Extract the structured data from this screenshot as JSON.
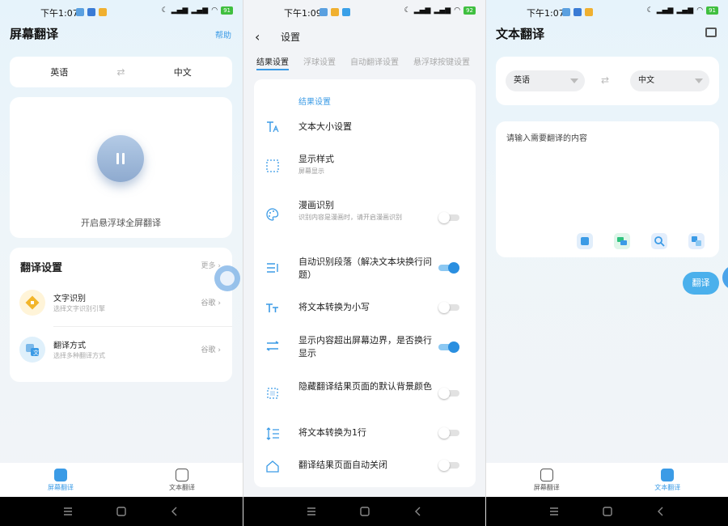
{
  "colors": {
    "accent": "#3b9be6",
    "toggle_on": "#2a8fe0",
    "page_bg": "#f2f4f7"
  },
  "screen1": {
    "status_time": "下午1:07",
    "title": "屏幕翻译",
    "help": "帮助",
    "source_lang": "英语",
    "target_lang": "中文",
    "swap_icon": "swap-arrows-icon",
    "float_caption": "开启悬浮球全屏翻译",
    "settings_title": "翻译设置",
    "settings_more": "更多 ›",
    "rows": [
      {
        "title": "文字识别",
        "subtitle": "选择文字识别引擎",
        "value": "谷歌 ›",
        "icon": "ocr-engine-icon"
      },
      {
        "title": "翻译方式",
        "subtitle": "选择多种翻译方式",
        "value": "谷歌 ›",
        "icon": "translate-method-icon"
      }
    ],
    "tabs": [
      "屏幕翻译",
      "文本翻译"
    ]
  },
  "screen2": {
    "status_time": "下午1:09",
    "back": "‹",
    "title": "设置",
    "subtabs": [
      "结果设置",
      "浮球设置",
      "自动翻译设置",
      "悬浮球按键设置"
    ],
    "section": "结果设置",
    "options": [
      {
        "title": "文本大小设置",
        "subtitle": "",
        "toggle": null,
        "icon": "text-size-icon"
      },
      {
        "title": "显示样式",
        "subtitle": "屏幕显示",
        "toggle": null,
        "icon": "display-style-icon"
      },
      {
        "title": "漫画识别",
        "subtitle": "识别内容是漫画时，请开启漫画识别",
        "toggle": false,
        "icon": "palette-icon"
      },
      {
        "title": "自动识别段落（解决文本块换行问题）",
        "subtitle": "",
        "toggle": true,
        "icon": "paragraph-icon"
      },
      {
        "title": "将文本转换为小写",
        "subtitle": "",
        "toggle": false,
        "icon": "lowercase-icon"
      },
      {
        "title": "显示内容超出屏幕边界，是否换行显示",
        "subtitle": "",
        "toggle": true,
        "icon": "wrap-icon"
      },
      {
        "title": "隐藏翻译结果页面的默认背景颜色",
        "subtitle": "",
        "toggle": false,
        "icon": "background-icon"
      },
      {
        "title": "将文本转换为1行",
        "subtitle": "",
        "toggle": false,
        "icon": "single-line-icon"
      },
      {
        "title": "翻译结果页面自动关闭",
        "subtitle": "",
        "toggle": false,
        "icon": "home-icon"
      }
    ]
  },
  "screen3": {
    "status_time": "下午1:07",
    "title": "文本翻译",
    "source_lang": "英语",
    "target_lang": "中文",
    "placeholder": "请输入需要翻译的内容",
    "translate": "翻译",
    "tabs": [
      "屏幕翻译",
      "文本翻译"
    ]
  }
}
